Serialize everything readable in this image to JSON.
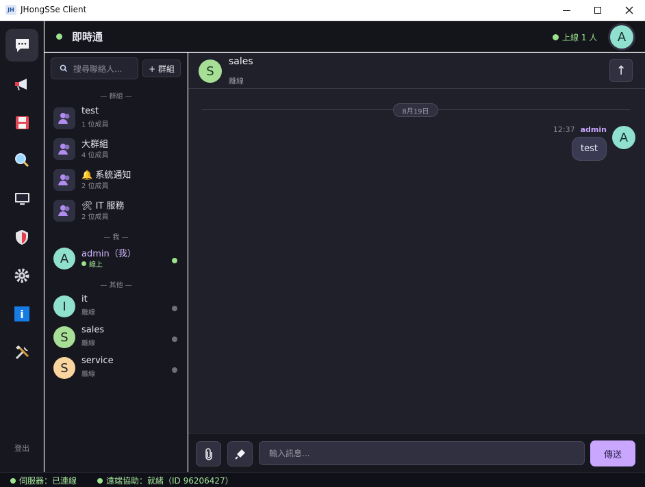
{
  "window": {
    "icon_text": "JH",
    "title": "JHongSSe Client"
  },
  "header": {
    "app_name": "即時通",
    "online_text": "上線 1 人",
    "user_initial": "A"
  },
  "rail": {
    "items": [
      {
        "icon": "chat-icon"
      },
      {
        "icon": "megaphone-icon"
      },
      {
        "icon": "save-icon"
      },
      {
        "icon": "search-icon"
      },
      {
        "icon": "monitor-icon"
      },
      {
        "icon": "shield-icon"
      },
      {
        "icon": "gear-icon"
      },
      {
        "icon": "info-icon",
        "text": "i"
      },
      {
        "icon": "tools-icon"
      }
    ],
    "logout_label": "登出"
  },
  "contacts": {
    "search_placeholder": "搜尋聯絡人...",
    "new_group_label": "+ 群組",
    "group_section": "— 群組 —",
    "me_section": "— 我 —",
    "others_section": "— 其他 —",
    "groups": [
      {
        "name": "test",
        "members": "1 位成員"
      },
      {
        "name": "大群組",
        "members": "4 位成員"
      },
      {
        "name": "🔔 系統通知",
        "members": "2 位成員"
      },
      {
        "name": "🛠 IT 服務",
        "members": "2 位成員"
      }
    ],
    "me": {
      "initial": "A",
      "name": "admin（我）",
      "status": "線上"
    },
    "others": [
      {
        "initial": "I",
        "name": "it",
        "status": "離線",
        "color": "#8fe0cf"
      },
      {
        "initial": "S",
        "name": "sales",
        "status": "離線",
        "color": "#a7df96"
      },
      {
        "initial": "S",
        "name": "service",
        "status": "離線",
        "color": "#fad59f"
      }
    ]
  },
  "chat": {
    "initial": "S",
    "name": "sales",
    "status": "離線",
    "date": "8月19日",
    "message": {
      "time": "12:37",
      "sender": "admin",
      "sender_initial": "A",
      "text": "test"
    },
    "scroll_up_label": "↑"
  },
  "composer": {
    "placeholder": "輸入訊息...",
    "send_label": "傳送"
  },
  "statusbar": {
    "server": "伺服器：已連線",
    "remote_assist": "遠端協助：就緒（ID 96206427）"
  },
  "colors": {
    "online": "#9be28c",
    "accent": "#c9a7ff",
    "background": "#17171f",
    "chat_background": "#20202b"
  }
}
